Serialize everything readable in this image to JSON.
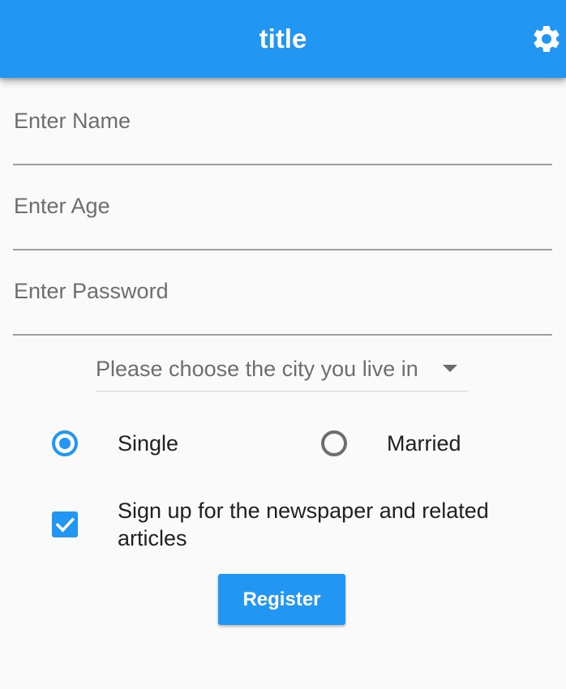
{
  "appbar": {
    "title": "title",
    "settings_icon": "gear-icon",
    "color": "#2196f3"
  },
  "form": {
    "name_placeholder": "Enter Name",
    "age_placeholder": "Enter Age",
    "password_placeholder": "Enter Password",
    "city_dropdown": {
      "selected_text": "Please choose the city you live in",
      "icon": "caret-down-icon"
    },
    "marital_status": {
      "options": [
        {
          "label": "Single",
          "selected": true
        },
        {
          "label": "Married",
          "selected": false
        }
      ]
    },
    "newsletter": {
      "label": "Sign up for the newspaper and related articles",
      "checked": true
    },
    "register_label": "Register"
  },
  "colors": {
    "accent": "#2196f3",
    "background": "#fafafa",
    "text": "#212121",
    "hint": "#6e6e6e"
  }
}
